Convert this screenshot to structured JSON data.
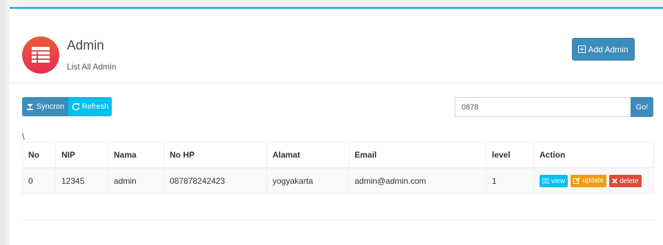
{
  "header": {
    "title": "Admin",
    "subtitle": "List All Admin",
    "icon": "table-list-icon",
    "add_button_label": "Add Admin"
  },
  "toolbar": {
    "sync_label": "Syncron",
    "refresh_label": "Refresh",
    "search_value": "0878",
    "go_label": "Go!",
    "stray_text": "\\"
  },
  "table": {
    "headers": [
      "No",
      "NIP",
      "Nama",
      "No HP",
      "Alamat",
      "Email",
      "level",
      "Action"
    ],
    "rows": [
      {
        "no": "0",
        "nip": "12345",
        "nama": "admin",
        "no_hp": "087878242423",
        "alamat": "yogyakarta",
        "email": "admin@admin.com",
        "level": "1",
        "actions": {
          "view": "view",
          "update": "update",
          "delete": "delete"
        }
      }
    ]
  },
  "colors": {
    "accent_top": "#3bb4ea",
    "primary": "#3c8dbc",
    "info": "#00c0ef",
    "warning": "#f39c12",
    "danger": "#dd4b39"
  }
}
